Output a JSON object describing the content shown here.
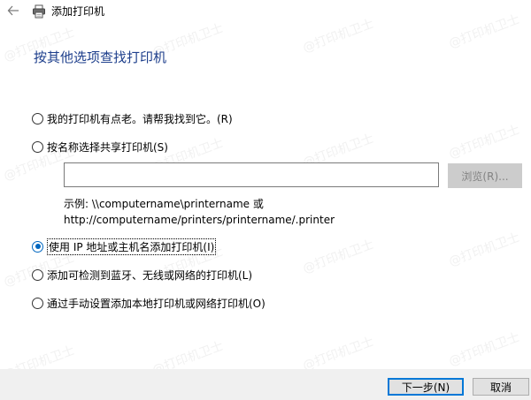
{
  "window": {
    "title": "添加打印机"
  },
  "heading": "按其他选项查找打印机",
  "options": [
    {
      "label": "我的打印机有点老。请帮我找到它。(R)",
      "selected": false
    },
    {
      "label": "按名称选择共享打印机(S)",
      "selected": false
    },
    {
      "label": "使用 IP 地址或主机名添加打印机(I)",
      "selected": true
    },
    {
      "label": "添加可检测到蓝牙、无线或网络的打印机(L)",
      "selected": false
    },
    {
      "label": "通过手动设置添加本地打印机或网络打印机(O)",
      "selected": false
    }
  ],
  "shared_printer": {
    "value": "",
    "browse_label": "浏览(R)...",
    "example_line1": "示例: \\\\computername\\printername 或",
    "example_line2": "http://computername/printers/printername/.printer"
  },
  "footer": {
    "next_label": "下一步(N)",
    "cancel_label": "取消"
  },
  "watermark": "@打印机卫士",
  "colors": {
    "heading": "#1e3f8c",
    "radio_selected": "#0067c0",
    "footer_bg": "#f0f0f0",
    "default_button_border": "#0078d7"
  },
  "icons": {
    "back": "back-arrow-icon",
    "app": "printer-icon"
  }
}
